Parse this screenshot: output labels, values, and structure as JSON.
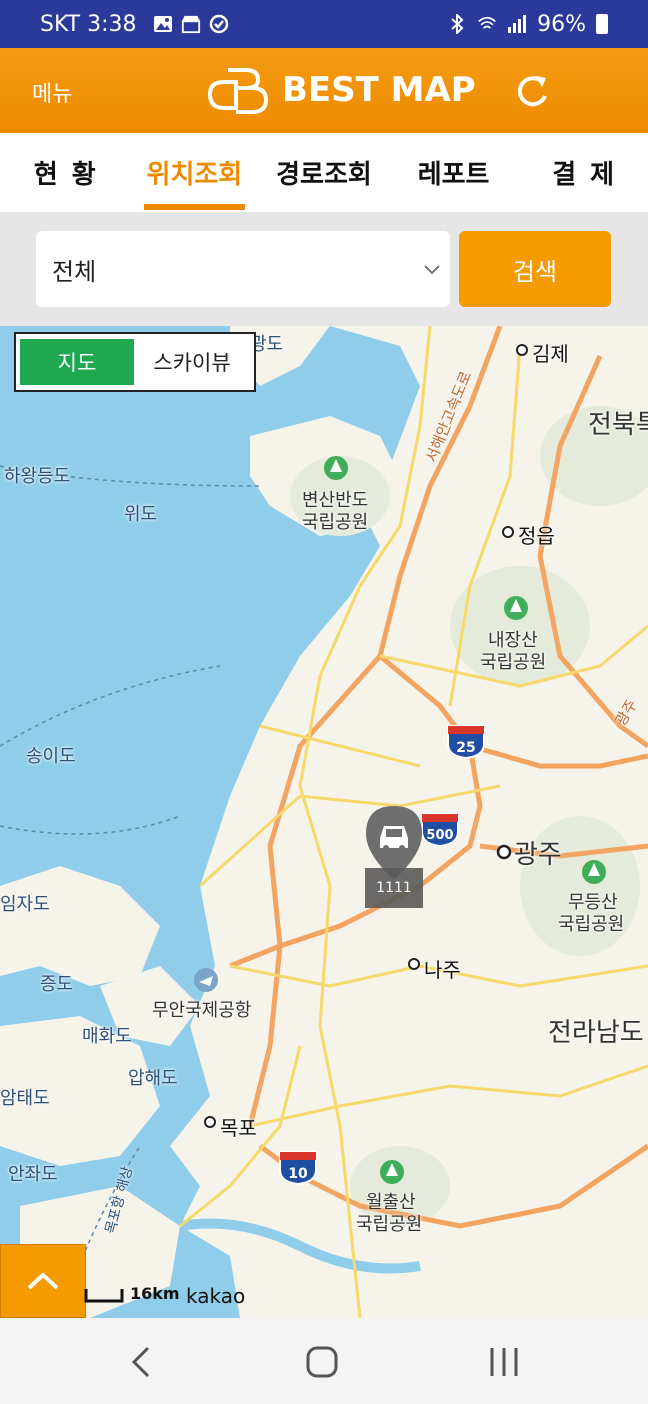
{
  "status_bar": {
    "carrier_time": "SKT 3:38",
    "battery": "96%"
  },
  "header": {
    "menu_label": "메뉴",
    "logo_text": "BEST MAP"
  },
  "tabs": [
    {
      "label": "현황"
    },
    {
      "label": "위치조회"
    },
    {
      "label": "경로조회"
    },
    {
      "label": "레포트"
    },
    {
      "label": "결제"
    }
  ],
  "search": {
    "selected": "전체",
    "button_label": "검색"
  },
  "map": {
    "toggle_map": "지도",
    "toggle_sky": "스카이뷰",
    "labels": {
      "gimje": "김제",
      "jeonbuk": "전북특",
      "hawangdeungdo": "하왕등도",
      "wido": "위도",
      "byeonsan": "변산반도",
      "park1": "국립공원",
      "jeongeup": "정읍",
      "naejangsan": "내장산",
      "park2": "국립공원",
      "songido": "송이도",
      "gwangju": "광주",
      "mudeungsan": "무등산",
      "park3": "국립공원",
      "imjado": "임자도",
      "naju": "나주",
      "jeungdo": "증도",
      "muan_airport": "무안국제공항",
      "maehwado": "매화도",
      "jeonnam": "전라남도",
      "aphaedo": "압해도",
      "amtaedo": "암태도",
      "mokpo": "목포",
      "anjwado": "안좌도",
      "wolchulsan": "월출산",
      "park4": "국립공원",
      "road_seohaean": "서해안고속도로",
      "road_gwangju": "광주",
      "road_mokpo": "목포항 해상",
      "gwangdo": "광도"
    },
    "shields": {
      "s25": "25",
      "s500": "500",
      "s10": "10"
    },
    "vehicle_label": "1111",
    "scale_label": "16km",
    "attribution": "kakao"
  },
  "colors": {
    "accent": "#ef8a00",
    "green": "#1fa84f",
    "status_bar": "#2b3a9a"
  }
}
